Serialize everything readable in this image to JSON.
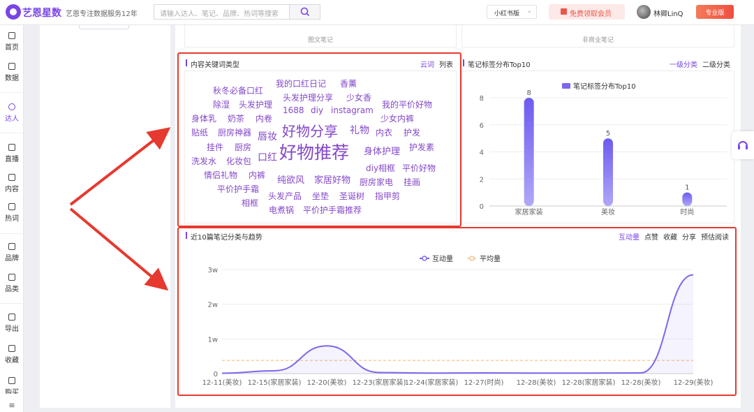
{
  "header": {
    "logo": "艺恩星数",
    "slogan": "艺恩专注数据服务12年",
    "search_placeholder": "请输入达人、笔记、品牌、热词等搜索",
    "version": "小红书版",
    "free_member": "免费领取会员",
    "username": "林卿LinQ",
    "pro_label": "专业版"
  },
  "sidebar": {
    "items": [
      {
        "label": "首页",
        "icon": "monitor-icon"
      },
      {
        "label": "数据",
        "icon": "bar-chart-icon"
      },
      {
        "label": "达人",
        "icon": "person-icon"
      },
      {
        "label": "直播",
        "icon": "play-icon"
      },
      {
        "label": "内容",
        "icon": "document-icon"
      },
      {
        "label": "热词",
        "icon": "trend-icon"
      },
      {
        "label": "品牌",
        "icon": "diamond-icon"
      },
      {
        "label": "品类",
        "icon": "box-icon"
      },
      {
        "label": "导出",
        "icon": "export-icon"
      },
      {
        "label": "收藏",
        "icon": "star-icon"
      },
      {
        "label": "购买",
        "icon": "cart-icon"
      }
    ],
    "active": "达人"
  },
  "top_cards": [
    "图文笔记",
    "非商业笔记"
  ],
  "keyword_panel": {
    "title": "内容关键词类型",
    "tabs": [
      "云词",
      "列表"
    ],
    "active_tab": "云词",
    "words": [
      "我的口红日记",
      "香薰",
      "秋冬必备口红",
      "头发护理分享",
      "少女香",
      "除湿",
      "头发护理",
      "我的平价好物",
      "身体乳",
      "奶茶",
      "内卷",
      "1688",
      "diy",
      "instagram",
      "少女内裤",
      "贴纸",
      "厨房神器",
      "唇妆",
      "好物分享",
      "礼物",
      "内衣",
      "护发",
      "挂件",
      "厨房",
      "口红",
      "好物推荐",
      "身体护理",
      "护发素",
      "洗发水",
      "化妆包",
      "diy相框",
      "平价好物",
      "情侣礼物",
      "内裤",
      "纯欲风",
      "家居好物",
      "厨房家电",
      "挂画",
      "平价护手霜",
      "头发产品",
      "坐垫",
      "圣诞树",
      "指甲剪",
      "相框",
      "电煮锅",
      "平价护手霜推荐"
    ]
  },
  "tag_panel": {
    "title": "笔记标签分布Top10",
    "tabs": [
      "一级分类",
      "二级分类"
    ],
    "active_tab": "一级分类"
  },
  "trend_panel": {
    "title": "近10篇笔记分类与趋势",
    "tabs": [
      "互动量",
      "点赞",
      "收藏",
      "分享",
      "预估阅读"
    ],
    "active_tab": "互动量"
  },
  "chart_data": [
    {
      "type": "bar",
      "title": "",
      "legend": [
        "笔记标签分布Top10"
      ],
      "categories": [
        "家居家装",
        "美妆",
        "时尚"
      ],
      "values": [
        8,
        5,
        1
      ],
      "ylim": [
        0,
        8
      ],
      "yticks": [
        0,
        2,
        4,
        6,
        8
      ],
      "grid": true,
      "color": "#7b68ee"
    },
    {
      "type": "line",
      "legend": [
        "互动量",
        "平均量"
      ],
      "categories": [
        "12-11(美妆)",
        "12-15(家居家装)",
        "12-20(美妆)",
        "12-23(家居家装)",
        "12-24(家居家装)",
        "12-27(时尚)",
        "12-28(美妆)",
        "12-28(家居家装)",
        "12-28(美妆)",
        "12-29(美妆)"
      ],
      "series": [
        {
          "name": "互动量",
          "values": [
            100,
            800,
            8000,
            300,
            150,
            200,
            150,
            150,
            200,
            28500
          ]
        },
        {
          "name": "平均量",
          "values": [
            3800,
            3800,
            3800,
            3800,
            3800,
            3800,
            3800,
            3800,
            3800,
            3800
          ]
        }
      ],
      "yticks": [
        "0",
        "1w",
        "2w",
        "3w"
      ],
      "ylim": [
        0,
        30000
      ],
      "colors": [
        "#7b68ee",
        "#f5c08a"
      ]
    }
  ]
}
